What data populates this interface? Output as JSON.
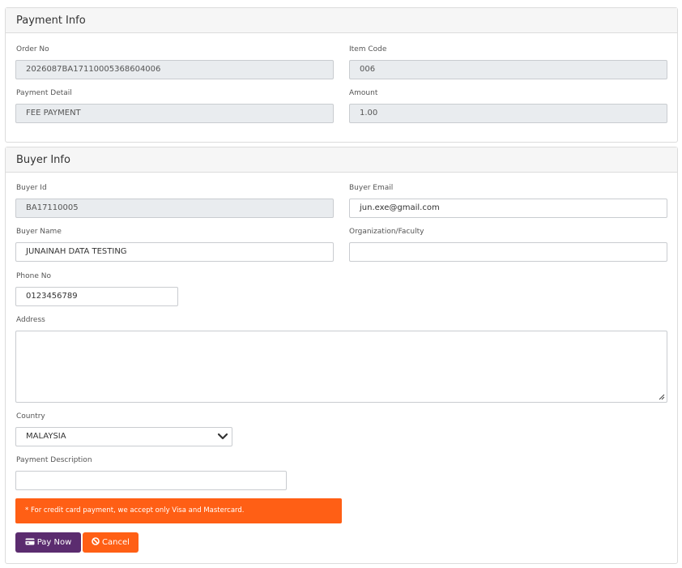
{
  "payment_info": {
    "title": "Payment Info",
    "order_no": {
      "label": "Order No",
      "value": "2026087BA17110005368604006"
    },
    "item_code": {
      "label": "Item Code",
      "value": "006"
    },
    "payment_detail": {
      "label": "Payment Detail",
      "value": "FEE PAYMENT"
    },
    "amount": {
      "label": "Amount",
      "value": "1.00"
    }
  },
  "buyer_info": {
    "title": "Buyer Info",
    "buyer_id": {
      "label": "Buyer Id",
      "value": "BA17110005"
    },
    "buyer_email": {
      "label": "Buyer Email",
      "value": "jun.exe@gmail.com"
    },
    "buyer_name": {
      "label": "Buyer Name",
      "value": "JUNAINAH DATA TESTING"
    },
    "organization": {
      "label": "Organization/Faculty",
      "value": ""
    },
    "phone_no": {
      "label": "Phone No",
      "value": "0123456789"
    },
    "address": {
      "label": "Address",
      "value": ""
    },
    "country": {
      "label": "Country",
      "value": "MALAYSIA"
    },
    "payment_description": {
      "label": "Payment Description",
      "value": ""
    }
  },
  "alert": {
    "text": "* For credit card payment, we accept only Visa and Mastercard."
  },
  "actions": {
    "pay_now_label": "Pay Now",
    "cancel_label": "Cancel"
  },
  "colors": {
    "primary": "#5b2c6f",
    "accent": "#ff5f15",
    "readonly_bg": "#e9ecef"
  },
  "icons": {
    "pay_now": "credit-card-icon",
    "cancel": "ban-icon",
    "country_select": "chevron-down-icon",
    "address_resize": "resize-grip-icon"
  }
}
